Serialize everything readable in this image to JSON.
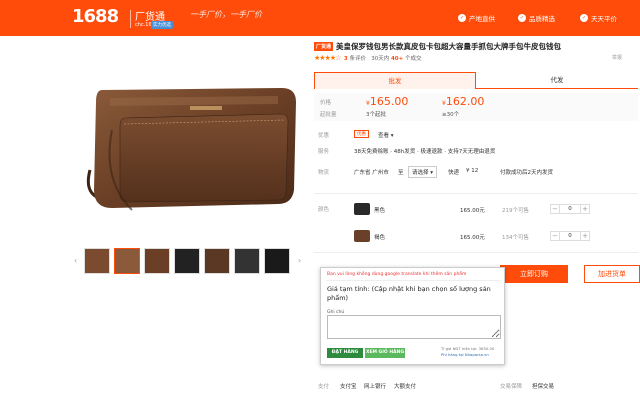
{
  "header": {
    "logo": "1688",
    "brand_name": "厂货通",
    "brand_url": "chc.1688.com",
    "brand_badge": "实力优选",
    "slogan": "一手厂价，一手厂价",
    "features": [
      {
        "icon": "check-circle-icon",
        "label": "产地直供"
      },
      {
        "icon": "check-circle-icon",
        "label": "品质精选"
      },
      {
        "icon": "check-circle-icon",
        "label": "天天平价"
      }
    ],
    "bg_color": "#ff4c0a"
  },
  "product": {
    "title_tag": "厂货通",
    "title": "美皇保罗钱包男长款真皮包卡包超大容量手抓包大牌手包牛皮包钱包",
    "stars": "★★★★☆",
    "rating_score": "3",
    "rating_text": "条评价",
    "sales_text": "30天内",
    "sales_count": "40+",
    "sales_suffix": "个成交",
    "report": "举报"
  },
  "tabs": [
    {
      "label": "批发",
      "active": true
    },
    {
      "label": "代发",
      "active": false
    }
  ],
  "price": {
    "label_price": "价格",
    "label_moq": "起批量",
    "tier1_currency": "¥",
    "tier1_value": "165.00",
    "tier1_moq": "3个起批",
    "tier2_currency": "¥",
    "tier2_value": "162.00",
    "tier2_moq": "≥30个"
  },
  "info": {
    "label_promo": "优惠",
    "promo_tag": "优惠",
    "promo_link": "查看",
    "label_service": "服务",
    "service_text": "38天免费赊账 · 48h发货 · 极速退款 · 支持7天无理由退货",
    "label_logistics": "物流",
    "ship_from": "广东省 广州市",
    "ship_to_label": "至",
    "ship_to": "请选择",
    "express": "快递",
    "express_fee": "¥ 12",
    "ship_note": "付款成功后2天内发货"
  },
  "sku": {
    "label_color": "颜色",
    "items": [
      {
        "name": "黑色",
        "price": "165.00元",
        "stock": "219个可售",
        "qty": "0"
      },
      {
        "name": "褐色",
        "price": "165.00元",
        "stock": "134个可售",
        "qty": "0"
      }
    ]
  },
  "actions": {
    "order": "立即订购",
    "cart": "加进货单"
  },
  "popup": {
    "warning": "Bạn vui lòng không dùng google translate khi thêm sản phẩm",
    "price_text": "Giá tạm tính: (Cập nhật khi bạn chọn số lượng sản phẩm)",
    "note_label": "Ghi chú",
    "note_placeholder": "",
    "btn_order": "ĐẶT HÀNG",
    "btn_cart": "XEM GIỎ HÀNG",
    "rate": "Tỉ giá NDT hiện tại: 3650.00",
    "fee": "Phí hàng tại Nhaparsa.vn"
  },
  "payment": {
    "label": "支付",
    "methods": [
      "支付宝",
      "网上银行",
      "大额支付"
    ],
    "guarantee_label": "交易保障",
    "guarantee": "担保交易"
  },
  "gallery": {
    "prev": "‹",
    "next": "›",
    "thumb_count": 7
  }
}
